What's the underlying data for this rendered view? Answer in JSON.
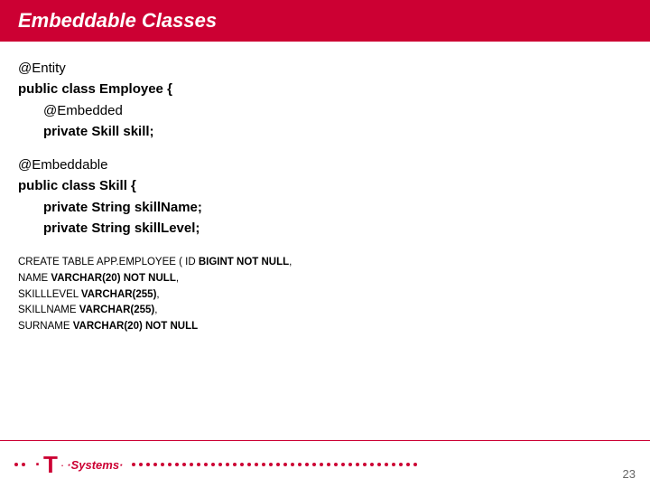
{
  "slide": {
    "title": "Embeddable Classes",
    "page_number": "23"
  },
  "code": {
    "line1": "@Entity",
    "line2_bold": "public class Employee {",
    "line3_indent": "@Embedded",
    "line4_indent": "private Skill skill;",
    "line5_empty": "",
    "line6": "@Embeddable",
    "line7_bold": "public class Skill {",
    "line8_indent": "private String skillName;",
    "line9_indent": "private String skillLevel;"
  },
  "sql": {
    "line1_normal": "CREATE TABLE APP.EMPLOYEE ( ID ",
    "line1_bold": "BIGINT NOT NULL",
    "line1_end": ",",
    "line2_normal": "NAME ",
    "line2_bold": "VARCHAR(20) NOT NULL",
    "line2_end": ",",
    "line3_normal": "SKILLLEVEL ",
    "line3_bold": "VARCHAR(255)",
    "line3_end": ",",
    "line4_normal": "SKILLNAME ",
    "line4_bold": "VARCHAR(255)",
    "line4_end": ",",
    "line5_normal": "SURNAME ",
    "line5_bold": "VARCHAR(20) NOT NULL"
  },
  "footer": {
    "logo_t": "T",
    "logo_systems": "·Systems·"
  }
}
